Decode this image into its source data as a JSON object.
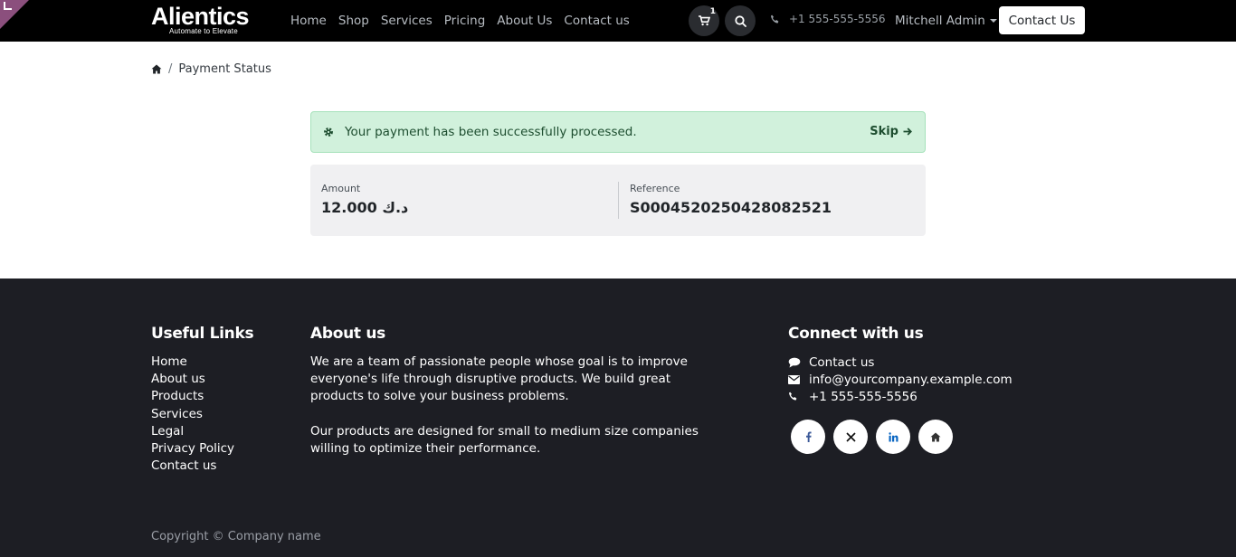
{
  "brand": {
    "name": "Alientics",
    "tagline": "Automate to Elevate"
  },
  "nav": {
    "items": [
      {
        "label": "Home"
      },
      {
        "label": "Shop"
      },
      {
        "label": "Services"
      },
      {
        "label": "Pricing"
      },
      {
        "label": "About Us"
      },
      {
        "label": "Contact us"
      }
    ],
    "cart_count": "1",
    "phone": "+1 555-555-5556",
    "user": "Mitchell Admin",
    "cta_label": "Contact Us"
  },
  "breadcrumb": {
    "home_icon": "home-icon",
    "current": "Payment Status"
  },
  "alert": {
    "icon": "gear-icon",
    "message": "Your payment has been successfully processed.",
    "skip_label": "Skip"
  },
  "summary": {
    "amount_label": "Amount",
    "amount_value": "12.000 د.ك",
    "reference_label": "Reference",
    "reference_value": "S00045202504280825­21"
  },
  "footer": {
    "useful_links_title": "Useful Links",
    "useful_links": [
      {
        "label": "Home"
      },
      {
        "label": "About us"
      },
      {
        "label": "Products"
      },
      {
        "label": "Services"
      },
      {
        "label": "Legal"
      },
      {
        "label": "Privacy Policy"
      },
      {
        "label": "Contact us"
      }
    ],
    "about_title": "About us",
    "about_p1": "We are a team of passionate people whose goal is to improve everyone's life through disruptive products. We build great products to solve your business problems.",
    "about_p2": "Our products are designed for small to medium size companies willing to optimize their performance.",
    "connect_title": "Connect with us",
    "connect_contact": "Contact us",
    "connect_email": "info@yourcompany.example.com",
    "connect_phone": "+1 555-555-5556",
    "socials": [
      "facebook-icon",
      "x-icon",
      "linkedin-icon",
      "home-icon"
    ],
    "copyright": "Copyright © Company name"
  },
  "colors": {
    "header_bg": "#000000",
    "alert_bg": "#d1f1dc",
    "alert_text": "#1d4d2f",
    "footer_bg": "#1d1e24",
    "corner_accent": "#8b4f7d"
  }
}
